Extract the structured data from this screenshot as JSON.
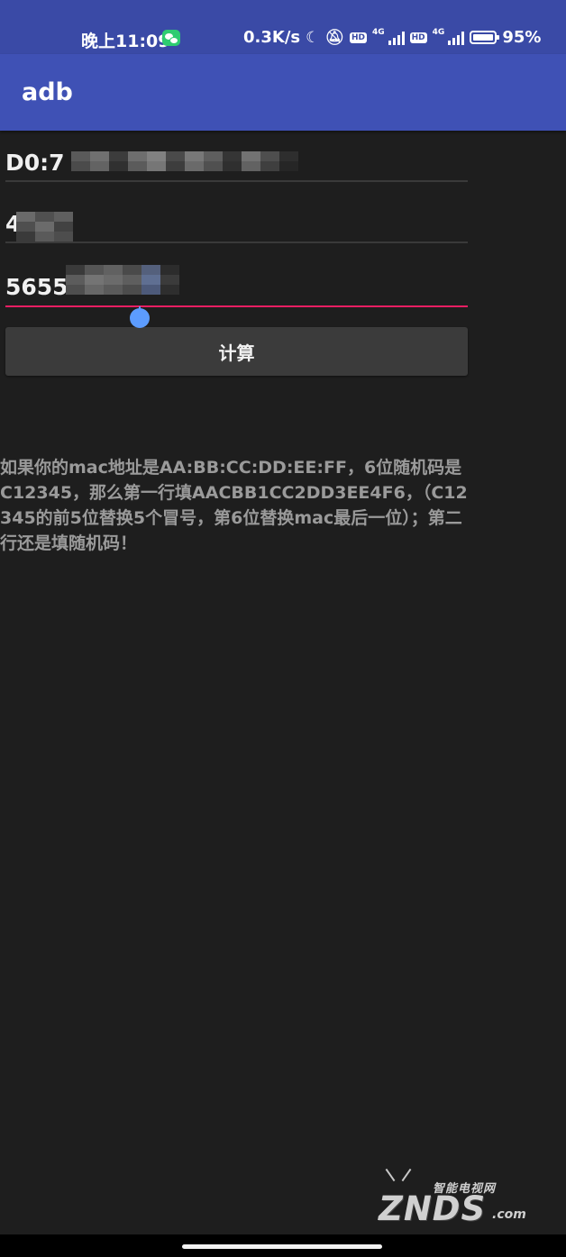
{
  "status_bar": {
    "time": "晚上11:09",
    "net_speed": "0.3K/s",
    "hd1": "HD",
    "net1": "4G",
    "hd2": "HD",
    "net2": "4G",
    "battery": "95%",
    "icons": [
      "wechat-icon",
      "moon-icon",
      "bell-off-icon",
      "signal-icon",
      "battery-icon"
    ]
  },
  "app_bar": {
    "title": "adb"
  },
  "fields": {
    "mac_value": "D0:7",
    "second_value": "4",
    "third_value": "5655"
  },
  "calc_button": {
    "label": "计算"
  },
  "hint": {
    "text": "如果你的mac地址是AA:BB:CC:DD:EE:FF，6位随机码是C12345，那么第一行填AACBB1CC2DD3EE4F6，（C12345的前5位替换5个冒号，第6位替换mac最后一位）；第二行还是填随机码！"
  },
  "watermark": {
    "small": "智能电视网",
    "big": "ZNDS",
    "suffix": ".com"
  },
  "colors": {
    "status_bar": "#3a4aa6",
    "app_bar": "#3f51b5",
    "background": "#1e1e1e",
    "accent": "#e91e63",
    "cursor_handle": "#5c9cff",
    "button": "#3b3b3b"
  }
}
